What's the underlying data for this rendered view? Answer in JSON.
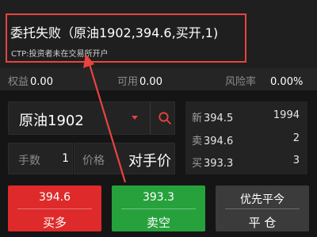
{
  "notification": {
    "title": "委托失败（原油1902,394.6,买开,1)",
    "subtitle": "CTP:投资者未在交易所开户"
  },
  "account": {
    "equity_label": "权益",
    "equity_value": "0.00",
    "available_label": "可用",
    "available_value": "0.00",
    "risk_label": "风险率",
    "risk_value": "0.00%"
  },
  "contract": {
    "name": "原油1902"
  },
  "quote": {
    "last_label": "新",
    "last_price": "394.5",
    "last_qty": "1994",
    "ask_label": "卖",
    "ask_price": "394.6",
    "ask_qty": "2",
    "bid_label": "买",
    "bid_price": "393.3",
    "bid_qty": "3"
  },
  "order": {
    "qty_label": "手数",
    "qty_value": "1",
    "price_label": "价格",
    "price_value": "对手价"
  },
  "buttons": {
    "buy_price": "394.6",
    "buy_label": "买多",
    "sell_price": "393.3",
    "sell_label": "卖空",
    "close_top": "优先平今",
    "close_label": "平 仓"
  },
  "colors": {
    "buy": "#de2a2a",
    "sell": "#27a13c",
    "close": "#3b3b3b",
    "highlight": "#e8433f"
  },
  "icons": {
    "dropdown": "caret-down-icon",
    "search": "search-icon"
  }
}
